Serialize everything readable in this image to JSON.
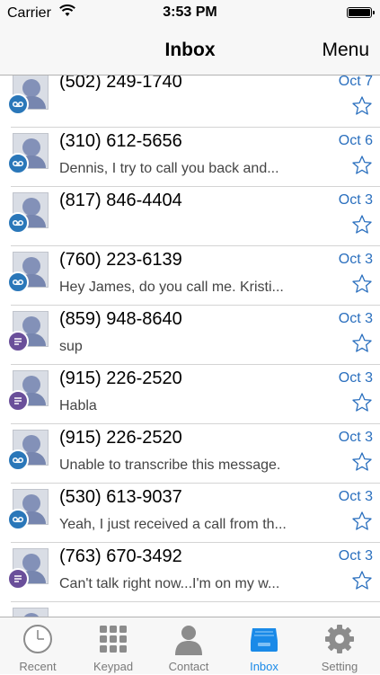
{
  "status_bar": {
    "carrier": "Carrier",
    "time": "3:53 PM"
  },
  "nav": {
    "title": "Inbox",
    "menu_label": "Menu"
  },
  "messages": [
    {
      "phone": "(502) 249-1740",
      "date": "Oct 7",
      "preview": "",
      "type": "voicemail"
    },
    {
      "phone": "(310) 612-5656",
      "date": "Oct 6",
      "preview": "Dennis, I try to call you back and...",
      "type": "voicemail"
    },
    {
      "phone": "(817) 846-4404",
      "date": "Oct 3",
      "preview": "",
      "type": "voicemail"
    },
    {
      "phone": "(760) 223-6139",
      "date": "Oct 3",
      "preview": "Hey James, do you call me. Kristi...",
      "type": "voicemail"
    },
    {
      "phone": "(859) 948-8640",
      "date": "Oct 3",
      "preview": "sup",
      "type": "text"
    },
    {
      "phone": "(915) 226-2520",
      "date": "Oct 3",
      "preview": "Habla",
      "type": "text"
    },
    {
      "phone": "(915) 226-2520",
      "date": "Oct 3",
      "preview": "Unable to transcribe this message.",
      "type": "voicemail"
    },
    {
      "phone": "(530) 613-9037",
      "date": "Oct 3",
      "preview": "Yeah, I just received a call from th...",
      "type": "voicemail"
    },
    {
      "phone": "(763) 670-3492",
      "date": "Oct 3",
      "preview": "Can't talk right now...I'm on my w...",
      "type": "text"
    }
  ],
  "tabs": [
    {
      "label": "Recent",
      "icon": "clock-icon"
    },
    {
      "label": "Keypad",
      "icon": "keypad-icon"
    },
    {
      "label": "Contact",
      "icon": "contact-icon"
    },
    {
      "label": "Inbox",
      "icon": "inbox-icon",
      "active": true
    },
    {
      "label": "Setting",
      "icon": "gear-icon"
    }
  ],
  "colors": {
    "accent": "#1a8ae8",
    "date_blue": "#2a6fbe",
    "voicemail_badge": "#2a77b9",
    "text_badge": "#6a4f9a"
  }
}
